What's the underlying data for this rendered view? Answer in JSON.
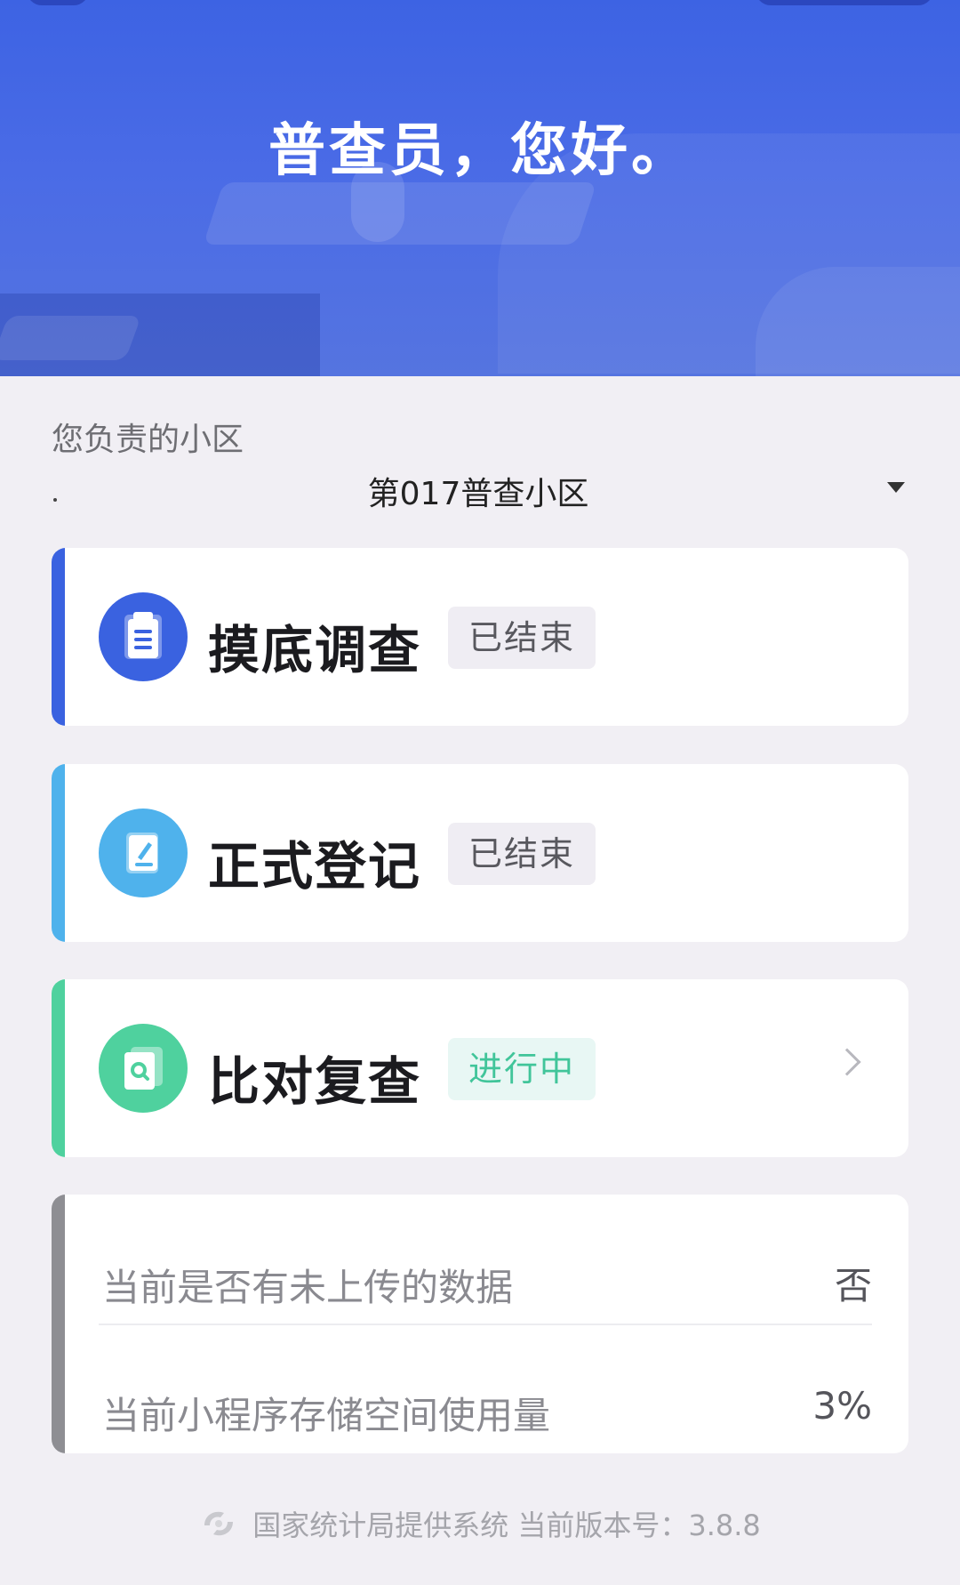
{
  "hero": {
    "greeting": "普查员，您好。"
  },
  "district": {
    "label": "您负责的小区",
    "value": "第017普查小区"
  },
  "stages": [
    {
      "title": "摸底调查",
      "status": "已结束",
      "icon": "clipboard-icon",
      "accent": "#3a62e0"
    },
    {
      "title": "正式登记",
      "status": "已结束",
      "icon": "edit-document-icon",
      "accent": "#4fb2ec"
    },
    {
      "title": "比对复查",
      "status": "进行中",
      "icon": "search-document-icon",
      "accent": "#4fd19e"
    }
  ],
  "info": {
    "unuploaded_label": "当前是否有未上传的数据",
    "unuploaded_value": "否",
    "storage_label": "当前小程序存储空间使用量",
    "storage_value": "3%"
  },
  "footer": {
    "text": "国家统计局提供系统  当前版本号：3.8.8"
  },
  "colors": {
    "hero_blue": "#4a6be6",
    "active_green": "#41c59a",
    "done_grey": "#58585e"
  }
}
